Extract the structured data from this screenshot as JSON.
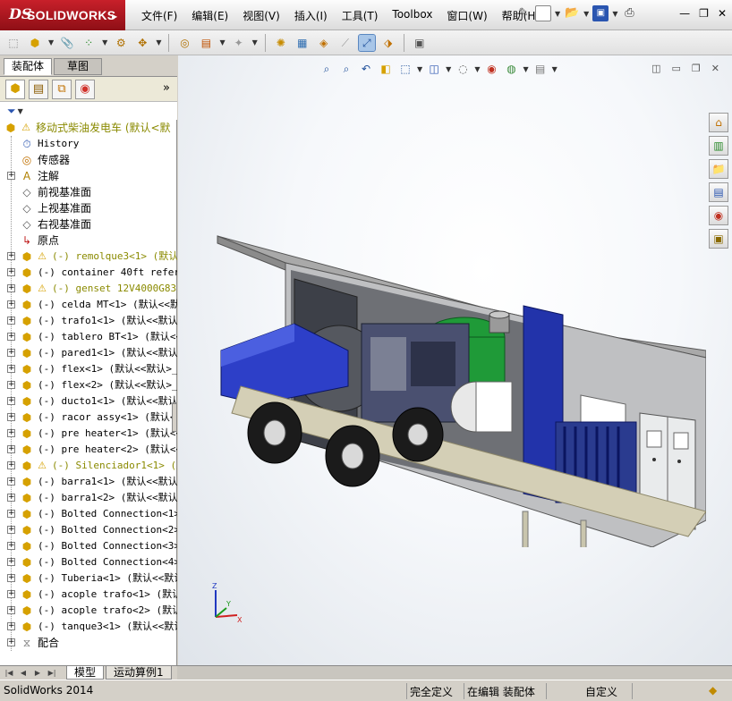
{
  "app": {
    "logo_mark": "DS",
    "logo_name": "SOLIDWORKS",
    "menu": [
      "文件(F)",
      "编辑(E)",
      "视图(V)",
      "插入(I)",
      "工具(T)",
      "Toolbox",
      "窗口(W)",
      "帮助(H)"
    ]
  },
  "left_panel": {
    "tabs": [
      "装配体",
      "草图"
    ],
    "more_glyph": "»",
    "tree": [
      {
        "label": "移动式柴油发电车  (默认<默",
        "icon": "assembly-icon",
        "warning": true,
        "expander": false,
        "indent": 0
      },
      {
        "label": "History",
        "icon": "history-icon",
        "warning": false,
        "expander": false,
        "indent": 1
      },
      {
        "label": "传感器",
        "icon": "sensor-icon",
        "warning": false,
        "expander": false,
        "indent": 1
      },
      {
        "label": "注解",
        "icon": "annotation-icon",
        "warning": false,
        "expander": true,
        "indent": 1
      },
      {
        "label": "前视基准面",
        "icon": "plane-icon",
        "warning": false,
        "expander": false,
        "indent": 1
      },
      {
        "label": "上视基准面",
        "icon": "plane-icon",
        "warning": false,
        "expander": false,
        "indent": 1
      },
      {
        "label": "右视基准面",
        "icon": "plane-icon",
        "warning": false,
        "expander": false,
        "indent": 1
      },
      {
        "label": "原点",
        "icon": "origin-icon",
        "warning": false,
        "expander": false,
        "indent": 1
      },
      {
        "label": "(-) remolque3<1> (默认<",
        "icon": "component-icon",
        "warning": true,
        "expander": true,
        "indent": 1
      },
      {
        "label": "(-) container 40ft referen",
        "icon": "component-icon",
        "warning": false,
        "expander": true,
        "indent": 1
      },
      {
        "label": "(-) genset 12V4000G83 r",
        "icon": "component-icon",
        "warning": true,
        "expander": true,
        "indent": 1
      },
      {
        "label": "(-) celda MT<1> (默认<<默",
        "icon": "component-icon",
        "warning": false,
        "expander": true,
        "indent": 1
      },
      {
        "label": "(-) trafo1<1> (默认<<默认",
        "icon": "component-icon",
        "warning": false,
        "expander": true,
        "indent": 1
      },
      {
        "label": "(-) tablero BT<1> (默认<<",
        "icon": "component-icon",
        "warning": false,
        "expander": true,
        "indent": 1
      },
      {
        "label": "(-) pared1<1> (默认<<默认",
        "icon": "component-icon",
        "warning": false,
        "expander": true,
        "indent": 1
      },
      {
        "label": "(-) flex<1> (默认<<默认>_",
        "icon": "component-icon",
        "warning": false,
        "expander": true,
        "indent": 1
      },
      {
        "label": "(-) flex<2> (默认<<默认>_",
        "icon": "component-icon",
        "warning": false,
        "expander": true,
        "indent": 1
      },
      {
        "label": "(-) ducto1<1> (默认<<默认",
        "icon": "component-icon",
        "warning": false,
        "expander": true,
        "indent": 1
      },
      {
        "label": "(-) racor assy<1> (默认<<",
        "icon": "component-icon",
        "warning": false,
        "expander": true,
        "indent": 1
      },
      {
        "label": "(-) pre heater<1> (默认<<",
        "icon": "component-icon",
        "warning": false,
        "expander": true,
        "indent": 1
      },
      {
        "label": "(-) pre heater<2> (默认<<",
        "icon": "component-icon",
        "warning": false,
        "expander": true,
        "indent": 1
      },
      {
        "label": "(-) Silenciador1<1> (默认",
        "icon": "component-icon",
        "warning": true,
        "expander": true,
        "indent": 1
      },
      {
        "label": "(-) barra1<1> (默认<<默认",
        "icon": "component-icon",
        "warning": false,
        "expander": true,
        "indent": 1
      },
      {
        "label": "(-) barra1<2> (默认<<默认",
        "icon": "component-icon",
        "warning": false,
        "expander": true,
        "indent": 1
      },
      {
        "label": "(-) Bolted Connection<1>",
        "icon": "component-icon",
        "warning": false,
        "expander": true,
        "indent": 1
      },
      {
        "label": "(-) Bolted Connection<2>",
        "icon": "component-icon",
        "warning": false,
        "expander": true,
        "indent": 1
      },
      {
        "label": "(-) Bolted Connection<3>",
        "icon": "component-icon",
        "warning": false,
        "expander": true,
        "indent": 1
      },
      {
        "label": "(-) Bolted Connection<4>",
        "icon": "component-icon",
        "warning": false,
        "expander": true,
        "indent": 1
      },
      {
        "label": "(-) Tuberia<1> (默认<<默认",
        "icon": "component-icon",
        "warning": false,
        "expander": true,
        "indent": 1
      },
      {
        "label": "(-) acople trafo<1> (默认<",
        "icon": "component-icon",
        "warning": false,
        "expander": true,
        "indent": 1
      },
      {
        "label": "(-) acople trafo<2> (默认<",
        "icon": "component-icon",
        "warning": false,
        "expander": true,
        "indent": 1
      },
      {
        "label": "(-) tanque3<1> (默认<<默认",
        "icon": "component-icon",
        "warning": false,
        "expander": true,
        "indent": 1
      },
      {
        "label": "配合",
        "icon": "mates-icon",
        "warning": false,
        "expander": true,
        "indent": 1
      }
    ]
  },
  "bottom_tabs": [
    "模型",
    "运动算例1"
  ],
  "status": {
    "app_version": "SolidWorks 2014",
    "definition": "完全定义",
    "mode": "在编辑 装配体",
    "units": "自定义"
  },
  "colors": {
    "logo_red": "#b51720",
    "selection_blue": "#a8c6e8",
    "container_blue": "#2233aa",
    "engine_green": "#1f9a38"
  }
}
